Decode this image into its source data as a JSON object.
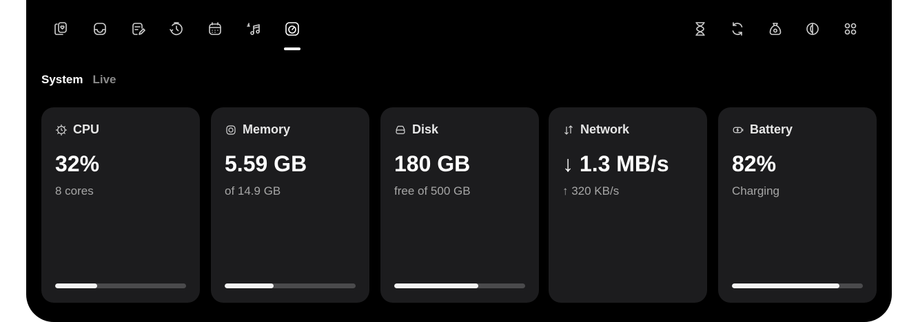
{
  "nav_icons": [
    {
      "name": "clipboard-heart-icon",
      "active": false
    },
    {
      "name": "inbox-tray-icon",
      "active": false
    },
    {
      "name": "note-edit-icon",
      "active": false
    },
    {
      "name": "timer-refresh-icon",
      "active": false
    },
    {
      "name": "calendar-icon",
      "active": false
    },
    {
      "name": "music-notes-icon",
      "active": false
    },
    {
      "name": "speedometer-icon",
      "active": true
    }
  ],
  "tool_icons": [
    {
      "name": "hourglass-icon"
    },
    {
      "name": "refresh-icon"
    },
    {
      "name": "money-bag-icon"
    },
    {
      "name": "contrast-icon"
    },
    {
      "name": "grid-apps-icon"
    }
  ],
  "tabs": {
    "active": "System",
    "inactive": "Live"
  },
  "cards": [
    {
      "icon": "cpu-chip-icon",
      "title": "CPU",
      "value": "32%",
      "subtitle": "8 cores",
      "progress": 0.32
    },
    {
      "icon": "memory-icon",
      "title": "Memory",
      "value": "5.59 GB",
      "subtitle": "of 14.9 GB",
      "progress": 0.375
    },
    {
      "icon": "disk-drive-icon",
      "title": "Disk",
      "value": "180 GB",
      "subtitle": "free of 500 GB",
      "progress": 0.64
    },
    {
      "icon": "network-arrows-icon",
      "title": "Network",
      "value": "↓ 1.3 MB/s",
      "subtitle": "↑ 320 KB/s",
      "progress": null
    },
    {
      "icon": "battery-charging-icon",
      "title": "Battery",
      "value": "82%",
      "subtitle": "Charging",
      "progress": 0.82
    }
  ],
  "colors": {
    "background": "#000000",
    "card": "#1c1c1e",
    "bar_track": "#4a4a4c",
    "bar_fill": "#f2f2f2",
    "text_primary": "#ffffff",
    "text_secondary": "#a6a6a6"
  }
}
